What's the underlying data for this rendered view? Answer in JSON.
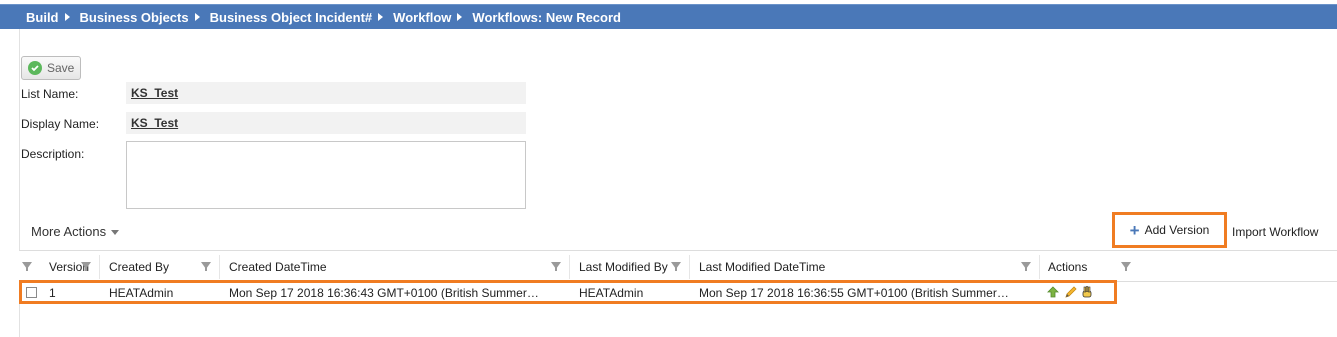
{
  "breadcrumb": [
    "Build",
    "Business Objects",
    "Business Object Incident#",
    "Workflow",
    "Workflows: New Record"
  ],
  "toolbar": {
    "save_label": "Save"
  },
  "form": {
    "list_name_label": "List Name:",
    "list_name_value": "KS_Test",
    "display_name_label": "Display Name:",
    "display_name_value": "KS_Test",
    "description_label": "Description:",
    "description_value": ""
  },
  "actions_bar": {
    "more_actions": "More Actions",
    "add_version": "Add Version",
    "import_workflow": "Import Workflow"
  },
  "grid": {
    "columns": [
      "Version",
      "Created By",
      "Created DateTime",
      "Last Modified By",
      "Last Modified DateTime",
      "Actions"
    ],
    "rows": [
      {
        "version": "1",
        "created_by": "HEATAdmin",
        "created_datetime": "Mon Sep 17 2018 16:36:43 GMT+0100 (British Summer…",
        "last_modified_by": "HEATAdmin",
        "last_modified_datetime": "Mon Sep 17 2018 16:36:55 GMT+0100 (British Summer…",
        "actions": [
          "publish-icon",
          "edit-pencil-icon",
          "hand-icon"
        ]
      }
    ]
  },
  "colors": {
    "header_bar": "#4a78b8",
    "highlight": "#f07c22",
    "accent": "#4a78b8"
  }
}
